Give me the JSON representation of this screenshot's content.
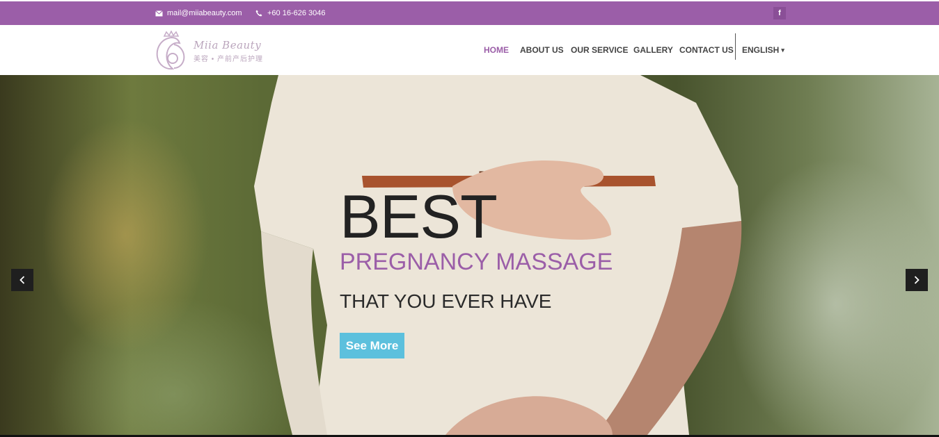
{
  "topbar": {
    "email": "mail@miiabeauty.com",
    "phone": "+60 16-626 3046",
    "email_icon": "envelope-icon",
    "phone_icon": "phone-icon",
    "social_icon": "facebook-icon",
    "social_label": "f"
  },
  "logo": {
    "name": "Miia Beauty",
    "subtitle": "美容 • 产前产后护理"
  },
  "nav": {
    "home": "HOME",
    "about": "ABOUT US",
    "service": "OUR SERVICE",
    "gallery": "GALLERY",
    "contact": "CONTACT US",
    "language": "ENGLISH",
    "language_icon": "chevron-down-icon",
    "active": "HOME"
  },
  "hero": {
    "headline": "BEST",
    "subheadline": "PREGNANCY MASSAGE",
    "tagline": "THAT YOU EVER HAVE",
    "button": "See More",
    "prev_icon": "chevron-left-icon",
    "next_icon": "chevron-right-icon"
  },
  "colors": {
    "brand": "#9b5ea8",
    "button": "#5cc0dd",
    "headline": "#222222"
  }
}
